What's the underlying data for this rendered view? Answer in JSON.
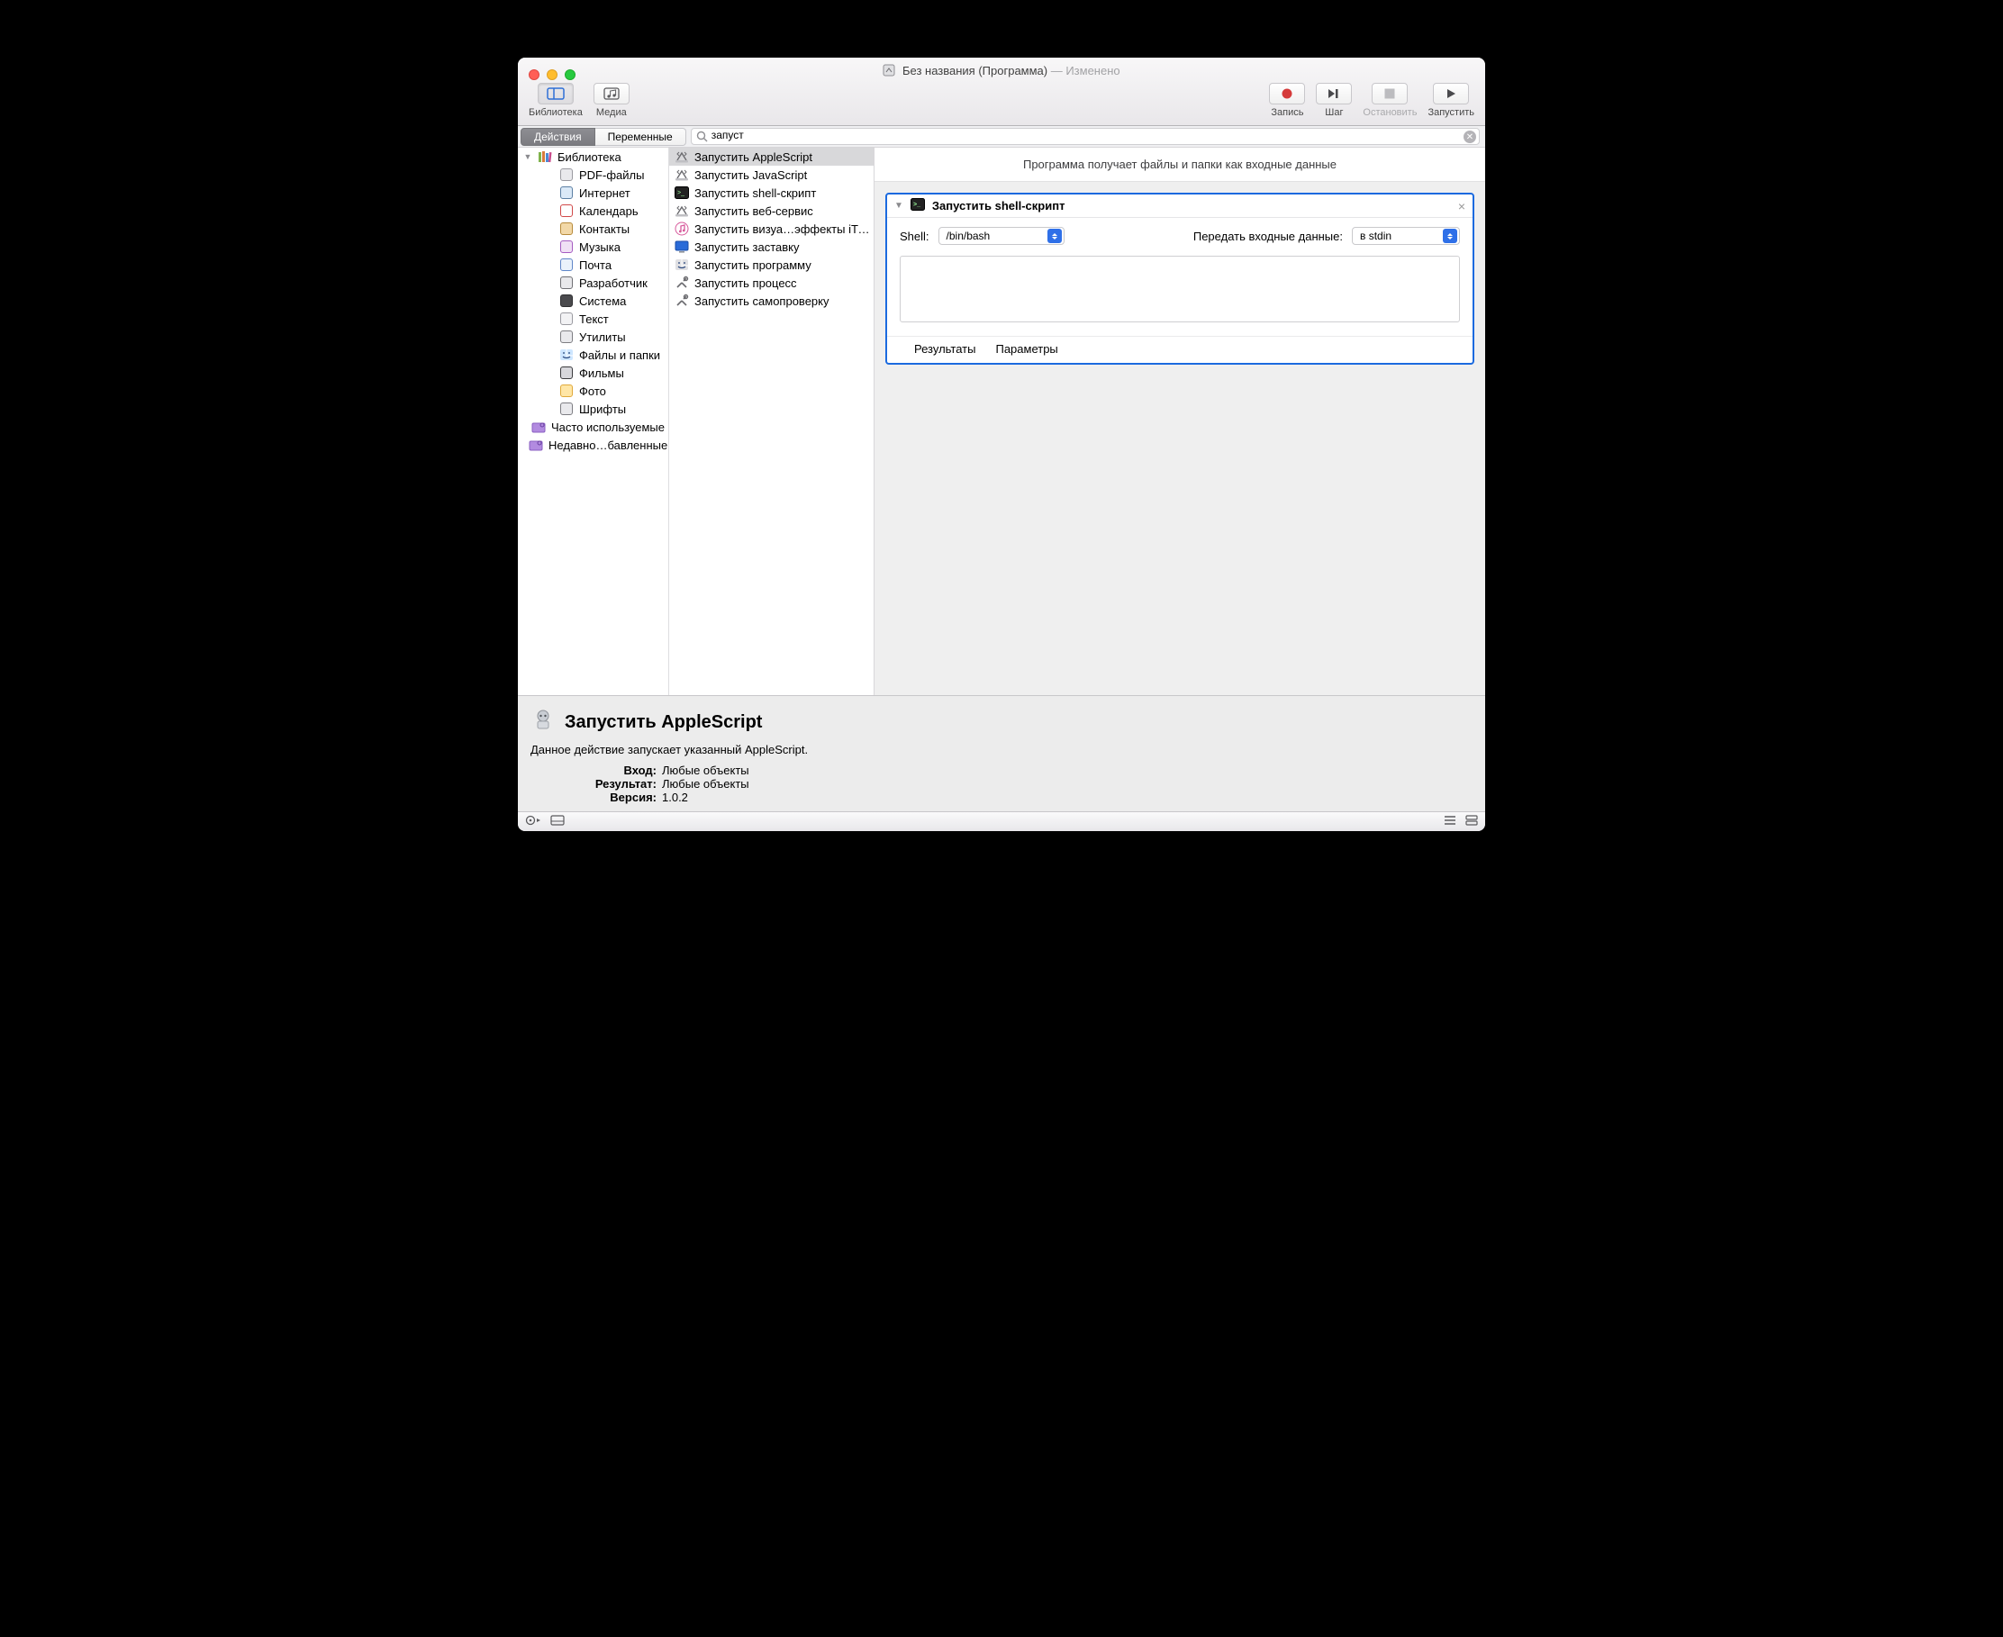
{
  "window": {
    "title_main": "Без названия (Программа)",
    "title_suffix": " — Изменено"
  },
  "toolbar": {
    "library": "Библиотека",
    "media": "Медиа",
    "record": "Запись",
    "step": "Шаг",
    "stop": "Остановить",
    "run": "Запустить"
  },
  "filter": {
    "seg_actions": "Действия",
    "seg_vars": "Переменные",
    "search_value": "запуст"
  },
  "library": {
    "root": "Библиотека",
    "items": [
      {
        "label": "PDF-файлы",
        "icon": "pdf",
        "fill": "#e9e9ec",
        "stroke": "#9a9aa0"
      },
      {
        "label": "Интернет",
        "icon": "globe",
        "fill": "#dbe9f7",
        "stroke": "#5b7fa3"
      },
      {
        "label": "Календарь",
        "icon": "calendar",
        "fill": "#ffffff",
        "stroke": "#d04848"
      },
      {
        "label": "Контакты",
        "icon": "contacts",
        "fill": "#f2d8a7",
        "stroke": "#b78a3a"
      },
      {
        "label": "Музыка",
        "icon": "music",
        "fill": "#f0e0f5",
        "stroke": "#a55bc1"
      },
      {
        "label": "Почта",
        "icon": "mail",
        "fill": "#eaf2fb",
        "stroke": "#5f86c8"
      },
      {
        "label": "Разработчик",
        "icon": "dev",
        "fill": "#e8e8eb",
        "stroke": "#6f6f74"
      },
      {
        "label": "Система",
        "icon": "system",
        "fill": "#4a4a4d",
        "stroke": "#2e2e30"
      },
      {
        "label": "Текст",
        "icon": "text",
        "fill": "#f2f2f4",
        "stroke": "#9a9aa0"
      },
      {
        "label": "Утилиты",
        "icon": "util",
        "fill": "#e9e9ec",
        "stroke": "#7d7d82"
      },
      {
        "label": "Файлы и папки",
        "icon": "finder",
        "fill": "#cde6ff",
        "stroke": "#2b7de9"
      },
      {
        "label": "Фильмы",
        "icon": "movies",
        "fill": "#d7d7db",
        "stroke": "#3b3b3e"
      },
      {
        "label": "Фото",
        "icon": "photos",
        "fill": "#ffe6a6",
        "stroke": "#e0a93a"
      },
      {
        "label": "Шрифты",
        "icon": "fonts",
        "fill": "#e9e9ec",
        "stroke": "#7d7d82"
      }
    ],
    "smart": [
      {
        "label": "Часто используемые"
      },
      {
        "label": "Недавно…бавленные"
      }
    ]
  },
  "actions": [
    {
      "label": "Запустить AppleScript",
      "icon": "script",
      "selected": true
    },
    {
      "label": "Запустить JavaScript",
      "icon": "script"
    },
    {
      "label": "Запустить shell-скрипт",
      "icon": "terminal"
    },
    {
      "label": "Запустить веб-сервис",
      "icon": "script"
    },
    {
      "label": "Запустить визуа…эффекты iTunes",
      "icon": "itunes"
    },
    {
      "label": "Запустить заставку",
      "icon": "screensaver"
    },
    {
      "label": "Запустить программу",
      "icon": "finder"
    },
    {
      "label": "Запустить процесс",
      "icon": "tools"
    },
    {
      "label": "Запустить самопроверку",
      "icon": "tools"
    }
  ],
  "flow": {
    "input_hint": "Программа получает файлы и папки как входные данные",
    "card": {
      "title": "Запустить shell-скрипт",
      "shell_label": "Shell:",
      "shell_value": "/bin/bash",
      "pass_label": "Передать входные данные:",
      "pass_value": "в stdin",
      "script_value": "",
      "tab_results": "Результаты",
      "tab_params": "Параметры"
    }
  },
  "info": {
    "title": "Запустить AppleScript",
    "desc": "Данное действие запускает указанный AppleScript.",
    "k_input": "Вход:",
    "v_input": "Любые объекты",
    "k_result": "Результат:",
    "v_result": "Любые объекты",
    "k_version": "Версия:",
    "v_version": "1.0.2"
  }
}
